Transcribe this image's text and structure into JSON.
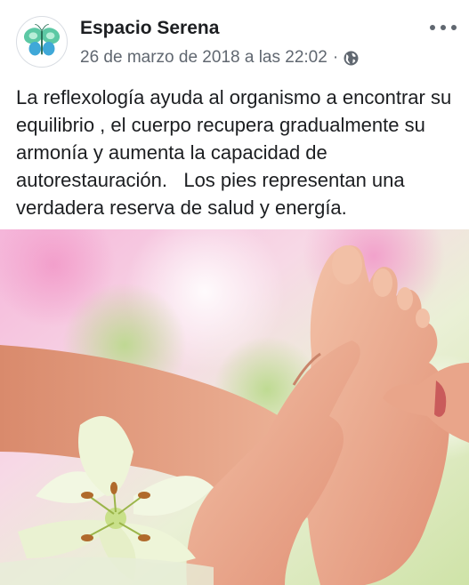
{
  "post": {
    "page_name": "Espacio Serena",
    "timestamp": "26 de marzo de 2018 a las 22:02",
    "separator": "·",
    "audience_icon": "globe-icon",
    "more_icon": "more-horizontal-icon",
    "avatar_icon": "butterfly-logo",
    "text": "La reflexología ayuda al organismo a encontrar su equilibrio , el cuerpo recupera gradualmente su armonía y aumenta la capacidad de autorestauración.   Los pies representan una verdadera reserva de salud y energía.",
    "image": {
      "subject": "reflexology-foot-massage-photo"
    }
  },
  "colors": {
    "text": "#1c1e21",
    "meta": "#606770",
    "butterfly": "#3fb98a",
    "petals": "#f2f7e2",
    "skin": "#e9a98e",
    "background_pink": "#f2a6d0"
  }
}
